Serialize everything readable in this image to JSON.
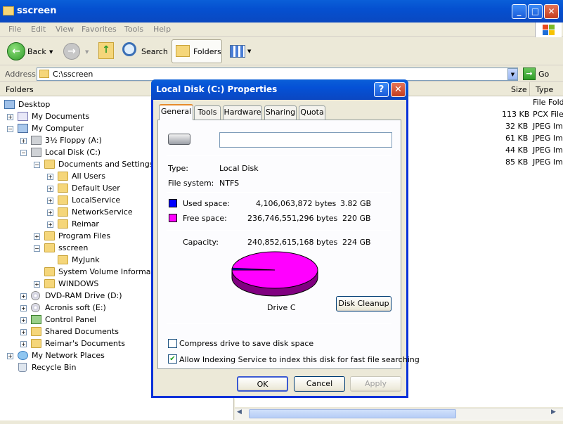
{
  "window": {
    "title": "sscreen"
  },
  "menu": [
    "File",
    "Edit",
    "View",
    "Favorites",
    "Tools",
    "Help"
  ],
  "toolbar": {
    "back": "Back",
    "search": "Search",
    "folders": "Folders"
  },
  "address": {
    "label": "Address",
    "value": "C:\\sscreen",
    "go": "Go"
  },
  "folders_pane": {
    "header": "Folders",
    "items": [
      {
        "label": "Desktop"
      },
      {
        "label": "My Documents"
      },
      {
        "label": "My Computer"
      },
      {
        "label": "3½ Floppy (A:)"
      },
      {
        "label": "Local Disk (C:)"
      },
      {
        "label": "Documents and Settings"
      },
      {
        "label": "All Users"
      },
      {
        "label": "Default User"
      },
      {
        "label": "LocalService"
      },
      {
        "label": "NetworkService"
      },
      {
        "label": "Reimar"
      },
      {
        "label": "Program Files"
      },
      {
        "label": "sscreen"
      },
      {
        "label": "MyJunk"
      },
      {
        "label": "System Volume Information"
      },
      {
        "label": "WINDOWS"
      },
      {
        "label": "DVD-RAM Drive (D:)"
      },
      {
        "label": "Acronis soft (E:)"
      },
      {
        "label": "Control Panel"
      },
      {
        "label": "Shared Documents"
      },
      {
        "label": "Reimar's Documents"
      },
      {
        "label": "My Network Places"
      },
      {
        "label": "Recycle Bin"
      }
    ]
  },
  "file_list": {
    "columns": [
      "Size",
      "Type"
    ],
    "rows": [
      {
        "size": "",
        "type": "File Fold"
      },
      {
        "size": "113 KB",
        "type": "PCX File"
      },
      {
        "size": "32 KB",
        "type": "JPEG Im"
      },
      {
        "size": "61 KB",
        "type": "JPEG Im"
      },
      {
        "size": "44 KB",
        "type": "JPEG Im"
      },
      {
        "size": "85 KB",
        "type": "JPEG Im"
      }
    ]
  },
  "dialog": {
    "title": "Local Disk (C:) Properties",
    "tabs": [
      "General",
      "Tools",
      "Hardware",
      "Sharing",
      "Quota"
    ],
    "name_value": "",
    "type_label": "Type:",
    "type_value": "Local Disk",
    "fs_label": "File system:",
    "fs_value": "NTFS",
    "used_label": "Used space:",
    "used_bytes": "4,106,063,872 bytes",
    "used_gb": "3.82 GB",
    "free_label": "Free space:",
    "free_bytes": "236,746,551,296 bytes",
    "free_gb": "220 GB",
    "capacity_label": "Capacity:",
    "capacity_bytes": "240,852,615,168 bytes",
    "capacity_gb": "224 GB",
    "drive_label": "Drive C",
    "cleanup_button": "Disk Cleanup",
    "compress_label": "Compress drive to save disk space",
    "compress_checked": false,
    "index_label": "Allow Indexing Service to index this disk for fast file searching",
    "index_checked": true,
    "ok": "OK",
    "cancel": "Cancel",
    "apply": "Apply",
    "used_color": "#0000ff",
    "free_color": "#ff00ff"
  }
}
